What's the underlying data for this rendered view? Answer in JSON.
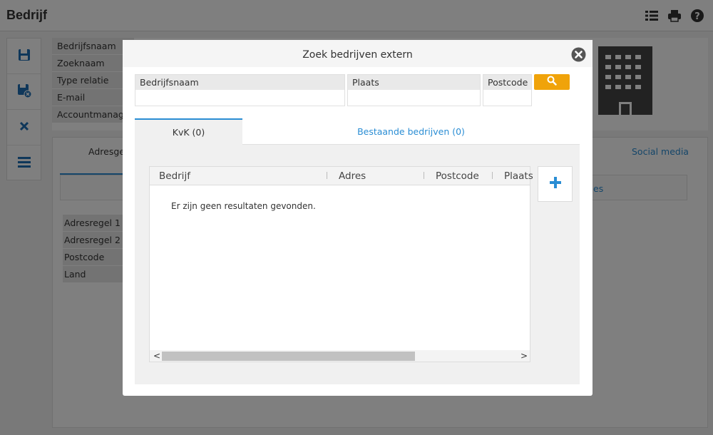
{
  "page": {
    "title": "Bedrijf",
    "header_icons": [
      "list-icon",
      "print-icon",
      "help-icon"
    ]
  },
  "toolbar": {
    "buttons": [
      "save-icon",
      "save-close-icon",
      "cancel-icon",
      "menu-icon"
    ]
  },
  "form": {
    "labels": [
      "Bedrijfsnaam",
      "Zoeknaam",
      "Type relatie",
      "E-mail",
      "Accountmanager"
    ]
  },
  "background_tabs": {
    "adres": "Adresgeg",
    "social": "Social media",
    "subbox_text": "es"
  },
  "address": {
    "labels": [
      "Adresregel 1",
      "Adresregel 2",
      "Postcode",
      "Land"
    ]
  },
  "modal": {
    "title": "Zoek bedrijven extern",
    "fields": {
      "bedrijfsnaam_label": "Bedrijfsnaam",
      "bedrijfsnaam_value": "",
      "plaats_label": "Plaats",
      "plaats_value": "",
      "postcode_label": "Postcode",
      "postcode_value": ""
    },
    "tabs": {
      "kvk": "KvK (0)",
      "bestaande": "Bestaande bedrijven (0)"
    },
    "table": {
      "columns": [
        "Bedrijf",
        "Adres",
        "Postcode",
        "Plaats"
      ],
      "empty_message": "Er zijn geen resultaten gevonden."
    },
    "scroll": {
      "left": "<",
      "right": ">"
    }
  },
  "colors": {
    "accent": "#2a8dd4",
    "search_button": "#f0a30a"
  }
}
